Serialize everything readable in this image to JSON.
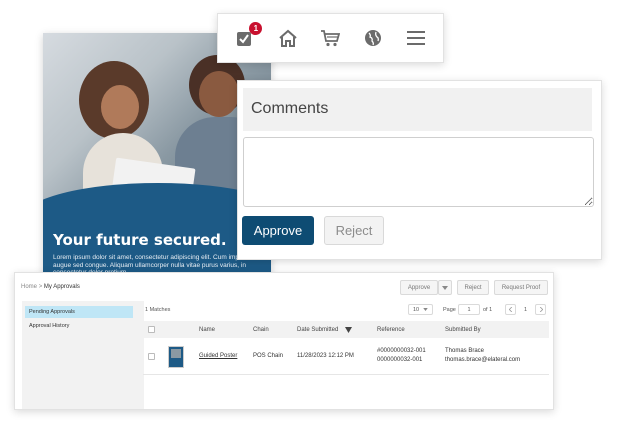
{
  "poster": {
    "title": "Your future secured.",
    "body": "Lorem ipsum dolor sit amet, consectetur adipiscing elit. Cum imperdiet id augue sed congue. Aliquam ullamcorper nulla vitae purus varius, in consectetur dolor pretium."
  },
  "navbar": {
    "items": [
      {
        "icon": "approval-check-icon",
        "badge": "1"
      },
      {
        "icon": "home-icon"
      },
      {
        "icon": "cart-icon"
      },
      {
        "icon": "globe-icon"
      },
      {
        "icon": "menu-icon"
      }
    ],
    "icon_color": "#6b6b6b",
    "badge_color": "#c8102e"
  },
  "comments": {
    "title": "Comments",
    "text_value": "",
    "approve_label": "Approve",
    "reject_label": "Reject",
    "accent_color": "#0e4c73"
  },
  "approvals": {
    "breadcrumb": {
      "home": "Home",
      "separator": ">",
      "current": "My Approvals"
    },
    "toolbar": {
      "approve_label": "Approve",
      "dropdown_icon": "caret-down-icon",
      "reject_label": "Reject",
      "request_proof_label": "Request Proof"
    },
    "sidebar": [
      {
        "label": "Pending Approvals",
        "active": true
      },
      {
        "label": "Approval History",
        "active": false
      }
    ],
    "matches": "1 Matches",
    "page_size": "10",
    "page_label": "Page",
    "page_value": "1",
    "of_label": "of 1",
    "page_current": "1",
    "columns": [
      "Name",
      "Chain",
      "Date Submitted",
      "Reference",
      "Submitted By"
    ],
    "sort_icon": "sort-down-icon",
    "rows": [
      {
        "name": "Guided Poster",
        "chain": "POS Chain",
        "date": "11/28/2023 12:12 PM",
        "reference_1": "#0000000032-001",
        "reference_2": "0000000032-001",
        "submitted_by_name": "Thomas Brace",
        "submitted_by_email": "thomas.brace@elateral.com"
      }
    ]
  }
}
